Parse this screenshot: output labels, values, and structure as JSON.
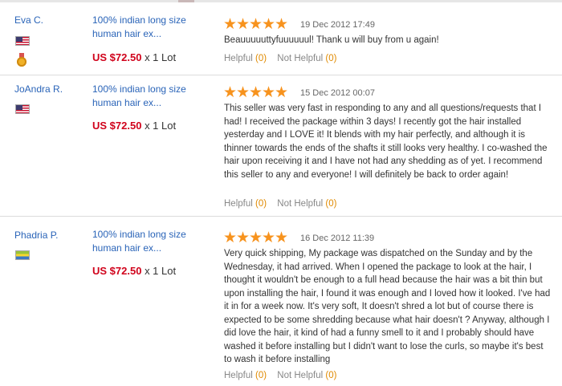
{
  "reviews": [
    {
      "buyer": "Eva C.",
      "flag": "us-flag",
      "has_medal": true,
      "product": "100% indian long size human hair ex...",
      "price": "US $72.50",
      "qty": "x 1 Lot",
      "rating": 5,
      "date": "19 Dec 2012 17:49",
      "text": "Beauuuuuttyfuuuuuul! Thank u will buy from u again!",
      "helpful_label": "Helpful",
      "helpful_count": "(0)",
      "not_helpful_label": "Not Helpful",
      "not_helpful_count": "(0)"
    },
    {
      "buyer": "JoAndra R.",
      "flag": "us-flag",
      "has_medal": false,
      "product": "100% indian long size human hair ex...",
      "price": "US $72.50",
      "qty": "x 1 Lot",
      "rating": 5,
      "date": "15 Dec 2012 00:07",
      "text": "This seller was very fast in responding to any and all questions/requests that I had! I received the package within 3 days! I recently got the hair installed yesterday and I LOVE it! It blends with my hair perfectly, and although it is thinner towards the ends of the shafts it still looks very healthy. I co-washed the hair upon receiving it and I have not had any shedding as of yet. I recommend this seller to any and everyone! I will definitely be back to order again!",
      "helpful_label": "Helpful",
      "helpful_count": "(0)",
      "not_helpful_label": "Not Helpful",
      "not_helpful_count": "(0)"
    },
    {
      "buyer": "Phadria P.",
      "flag": "country-flag",
      "has_medal": false,
      "product": "100% indian long size human hair ex...",
      "price": "US $72.50",
      "qty": "x 1 Lot",
      "rating": 5,
      "date": "16 Dec 2012 11:39",
      "text": "Very quick shipping, My package was dispatched on the Sunday and by the Wednesday, it had arrived. When I opened the package to look at the hair, I thought it wouldn't be enough to a full head because the hair was a bit thin but upon installing the hair, I found it was enough and I loved how it looked. I've had it in for a week now. It's very soft, It doesn't shred a lot but of course there is expected to be some shredding because what hair doesn't ? Anyway, although I did love the hair, it kind of had a funny smell to it and I probably should have washed it before installing but I didn't want to lose the curls, so maybe it's best to wash it before installing",
      "helpful_label": "Helpful",
      "helpful_count": "(0)",
      "not_helpful_label": "Not Helpful",
      "not_helpful_count": "(0)"
    }
  ],
  "colors": {
    "link": "#2a64b8",
    "price": "#d0021b",
    "star": "#f7931e",
    "count": "#e08a00"
  }
}
